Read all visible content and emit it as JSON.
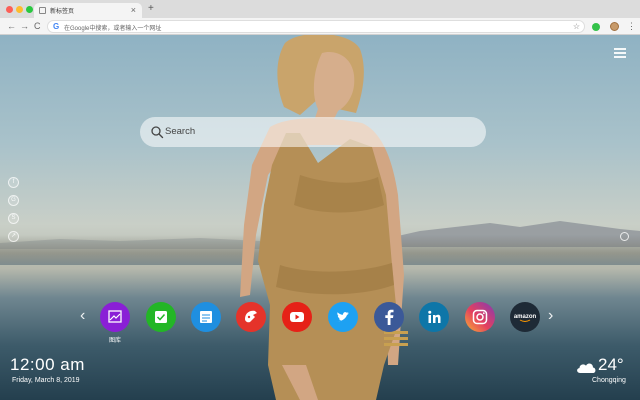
{
  "browser": {
    "tab_title": "新标签页",
    "tab_close": "×",
    "new_tab": "+",
    "nav_back": "←",
    "nav_forward": "→",
    "nav_reload": "C",
    "omnibox_g": "G",
    "omnibox_placeholder": "在Google中搜索，或者输入一个网址",
    "star": "☆",
    "menu": "⋮"
  },
  "search": {
    "placeholder": "Search"
  },
  "social_icons": [
    "facebook-icon",
    "google-plus-icon",
    "skype-icon",
    "share-icon"
  ],
  "shortcuts": {
    "items": [
      {
        "name": "gallery",
        "color": "#8a1fd6",
        "label": "图库"
      },
      {
        "name": "tasks",
        "color": "#23b626"
      },
      {
        "name": "notes",
        "color": "#1f8fe0"
      },
      {
        "name": "game",
        "color": "#e5332a"
      },
      {
        "name": "youtube",
        "color": "#e62117"
      },
      {
        "name": "twitter",
        "color": "#1da1f2"
      },
      {
        "name": "facebook",
        "color": "#3b5998"
      },
      {
        "name": "linkedin",
        "color": "#0e76a8"
      },
      {
        "name": "instagram",
        "color": "#c13584"
      },
      {
        "name": "amazon",
        "color": "#1e2a36",
        "text": "amazon"
      }
    ],
    "prev": "‹",
    "next": "›",
    "first_label": "图库"
  },
  "clock": {
    "time": "12:00 am",
    "date": "Friday, March 8, 2019"
  },
  "weather": {
    "temp": "24°",
    "city": "Chongqing",
    "icon": "cloud-icon"
  }
}
